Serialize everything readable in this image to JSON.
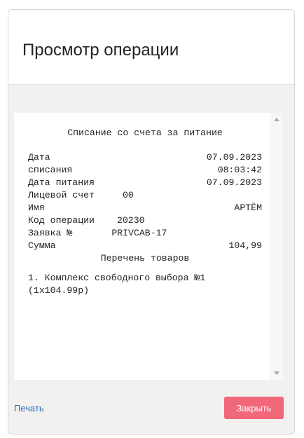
{
  "modal": {
    "title": "Просмотр операции"
  },
  "receipt": {
    "heading": "Списание со счета за питание",
    "rows": [
      {
        "label": "Дата",
        "value": "07.09.2023"
      },
      {
        "label": "списания",
        "value": "08:03:42"
      },
      {
        "label": "Дата питания",
        "value": "07.09.2023"
      },
      {
        "label": "Лицевой счет",
        "value": "00"
      },
      {
        "label": "Имя",
        "value": "АРТЁМ"
      },
      {
        "label": "Код операции",
        "value": "20230"
      },
      {
        "label": "Заявка №",
        "value": "PRIVCAB-17"
      },
      {
        "label": "Сумма",
        "value": "104,99"
      }
    ],
    "goods_heading": "Перечень товаров",
    "items": [
      "1. Комплекс свободного выбора №1 (1x104.99р)"
    ]
  },
  "footer": {
    "print_label": "Печать",
    "close_label": "Закрыть"
  },
  "colors": {
    "close_button_bg": "#f0687a",
    "link": "#2a6ebb",
    "modal_body_bg": "#f2f1ef"
  }
}
